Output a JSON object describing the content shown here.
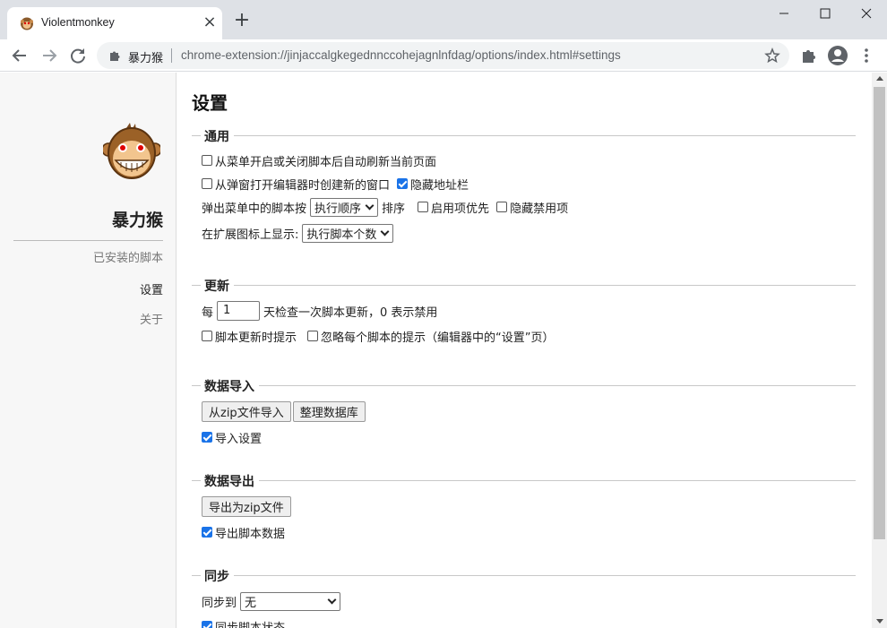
{
  "browser": {
    "tab_title": "Violentmonkey",
    "new_tab_glyph": "+",
    "close_glyph": "×",
    "omnibox": {
      "site_label": "暴力猴",
      "url": "chrome-extension://jinjaccalgkegednnccohejagnlnfdag/options/index.html#settings"
    },
    "icons": [
      "back-arrow-icon",
      "forward-arrow-icon",
      "reload-icon",
      "puzzle-icon",
      "star-icon",
      "extensions-icon",
      "profile-icon",
      "more-menu-icon",
      "minimize-icon",
      "maximize-icon",
      "close-icon"
    ]
  },
  "sidebar": {
    "brand": "暴力猴",
    "items": [
      {
        "label": "已安装的脚本"
      },
      {
        "label": "设置"
      },
      {
        "label": "关于"
      }
    ]
  },
  "settings": {
    "title": "设置",
    "general": {
      "heading": "通用",
      "auto_reload": {
        "label": "从菜单开启或关闭脚本后自动刷新当前页面",
        "checked": false
      },
      "editor_window": {
        "label": "从弹窗打开编辑器时创建新的窗口",
        "checked": false
      },
      "hide_address": {
        "label": "隐藏地址栏",
        "checked": true
      },
      "popup_sort": {
        "prefix": "弹出菜单中的脚本按",
        "select_value": "执行顺序",
        "suffix": "排序"
      },
      "enabled_first": {
        "label": "启用项优先",
        "checked": false
      },
      "hide_disabled": {
        "label": "隐藏禁用项",
        "checked": false
      },
      "badge": {
        "prefix": "在扩展图标上显示:",
        "select_value": "执行脚本个数"
      }
    },
    "update": {
      "heading": "更新",
      "prefix": "每",
      "days_value": "1",
      "suffix": "天检查一次脚本更新，0 表示禁用",
      "notify": {
        "label": "脚本更新时提示",
        "checked": false
      },
      "ignore_notify": {
        "label": "忽略每个脚本的提示（编辑器中的“设置”页）",
        "checked": false
      }
    },
    "import": {
      "heading": "数据导入",
      "zip_button": "从zip文件导入",
      "vacuum_button": "整理数据库",
      "import_settings": {
        "label": "导入设置",
        "checked": true
      }
    },
    "export": {
      "heading": "数据导出",
      "zip_button": "导出为zip文件",
      "export_values": {
        "label": "导出脚本数据",
        "checked": true
      }
    },
    "sync": {
      "heading": "同步",
      "prefix": "同步到",
      "select_value": "无",
      "sync_state": {
        "label": "同步脚本状态",
        "checked": true
      }
    }
  },
  "colors": {
    "accent": "#1a73e8",
    "tabstrip": "#dee1e6",
    "sidebar_bg": "#f7f7f7"
  }
}
